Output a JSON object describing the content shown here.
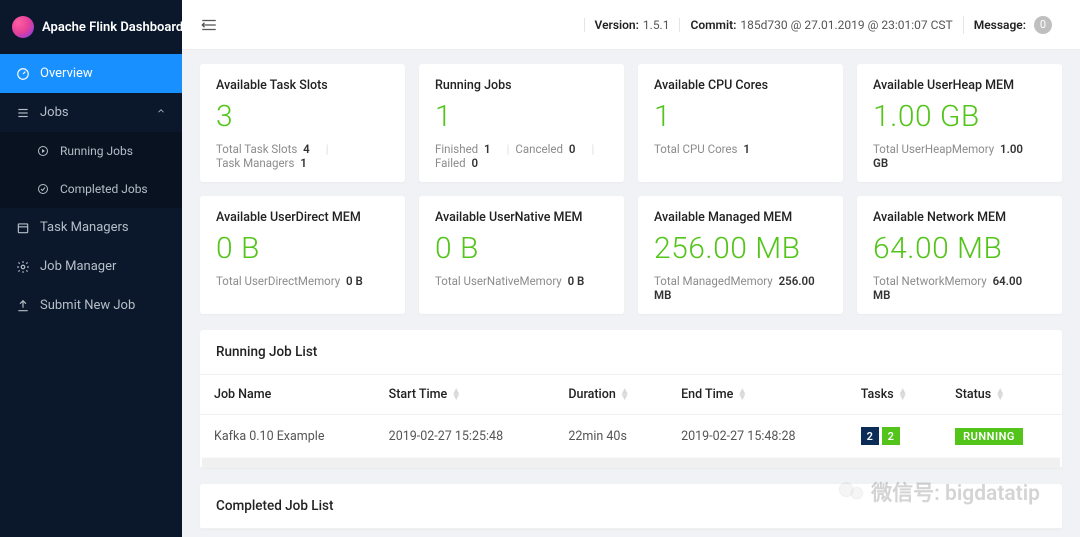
{
  "brand": {
    "title": "Apache Flink Dashboard"
  },
  "topbar": {
    "version_label": "Version:",
    "version_value": "1.5.1",
    "commit_label": "Commit:",
    "commit_value": "185d730 @ 27.01.2019 @ 23:01:07 CST",
    "message_label": "Message:",
    "message_count": "0"
  },
  "sidebar": {
    "overview": "Overview",
    "jobs": "Jobs",
    "running_jobs": "Running Jobs",
    "completed_jobs": "Completed Jobs",
    "task_managers": "Task Managers",
    "job_manager": "Job Manager",
    "submit_new_job": "Submit New Job"
  },
  "cards": [
    {
      "title": "Available Task Slots",
      "value": "3",
      "foot": [
        {
          "label": "Total Task Slots",
          "value": "4"
        },
        {
          "label": "Task Managers",
          "value": "1"
        }
      ],
      "divider_after": 0
    },
    {
      "title": "Running Jobs",
      "value": "1",
      "foot": [
        {
          "label": "Finished",
          "value": "1"
        },
        {
          "label": "Canceled",
          "value": "0"
        },
        {
          "label": "Failed",
          "value": "0"
        }
      ],
      "divider_after_each": true
    },
    {
      "title": "Available CPU Cores",
      "value": "1",
      "foot": [
        {
          "label": "Total CPU Cores",
          "value": "1"
        }
      ]
    },
    {
      "title": "Available UserHeap MEM",
      "value": "1.00 GB",
      "foot": [
        {
          "label": "Total UserHeapMemory",
          "value": "1.00 GB"
        }
      ]
    },
    {
      "title": "Available UserDirect MEM",
      "value": "0 B",
      "foot": [
        {
          "label": "Total UserDirectMemory",
          "value": "0 B"
        }
      ]
    },
    {
      "title": "Available UserNative MEM",
      "value": "0 B",
      "foot": [
        {
          "label": "Total UserNativeMemory",
          "value": "0 B"
        }
      ]
    },
    {
      "title": "Available Managed MEM",
      "value": "256.00 MB",
      "foot": [
        {
          "label": "Total ManagedMemory",
          "value": "256.00 MB"
        }
      ]
    },
    {
      "title": "Available Network MEM",
      "value": "64.00 MB",
      "foot": [
        {
          "label": "Total NetworkMemory",
          "value": "64.00 MB"
        }
      ]
    }
  ],
  "running_list": {
    "title": "Running Job List",
    "columns": [
      "Job Name",
      "Start Time",
      "Duration",
      "End Time",
      "Tasks",
      "Status"
    ],
    "row": {
      "name": "Kafka 0.10 Example",
      "start": "2019-02-27 15:25:48",
      "duration": "22min 40s",
      "end": "2019-02-27 15:48:28",
      "tasks_a": "2",
      "tasks_b": "2",
      "status": "RUNNING"
    }
  },
  "completed_list": {
    "title": "Completed Job List"
  },
  "watermark": "微信号: bigdatatip"
}
